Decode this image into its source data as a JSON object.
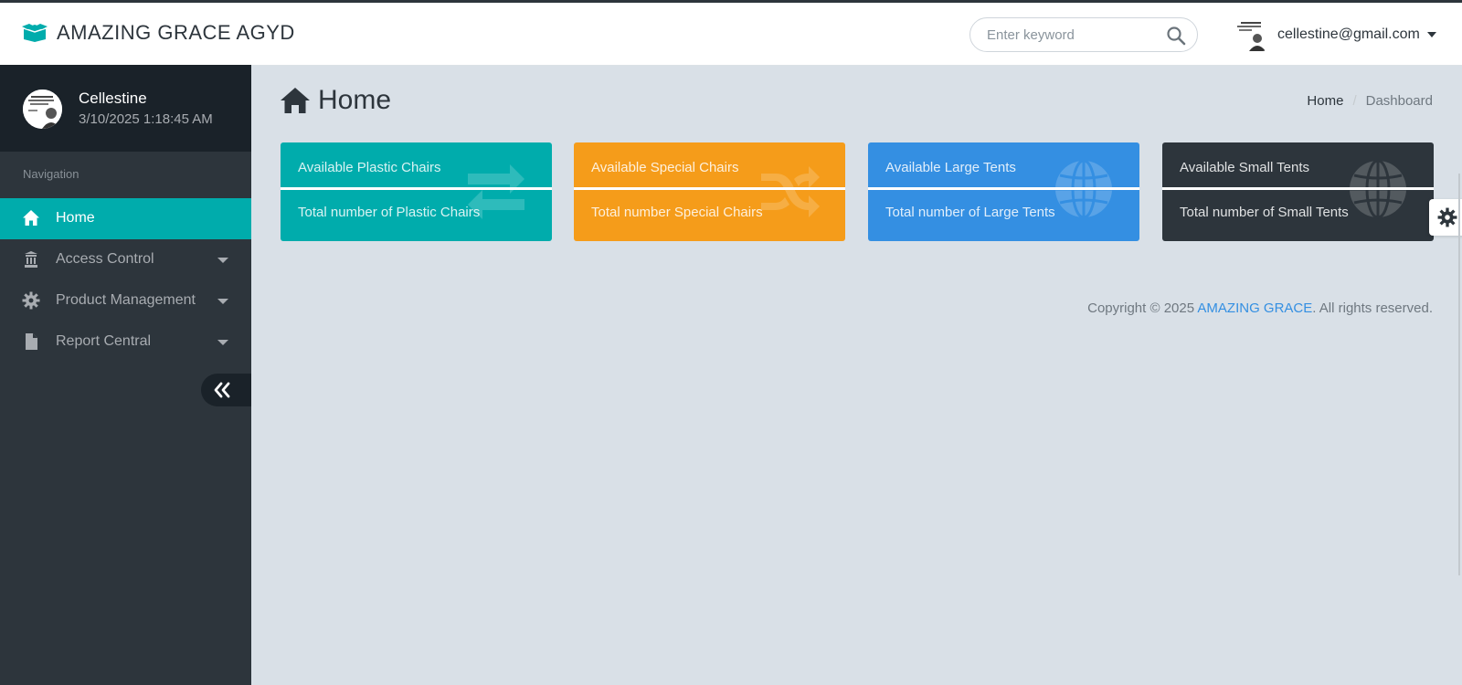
{
  "header": {
    "brand": "AMAZING GRACE AGYD",
    "search_placeholder": "Enter keyword",
    "user_email": "cellestine@gmail.com"
  },
  "sidebar": {
    "profile": {
      "name": "Cellestine",
      "timestamp": "3/10/2025 1:18:45 AM"
    },
    "nav_header": "Navigation",
    "items": [
      {
        "label": "Home",
        "icon": "home-icon",
        "active": true
      },
      {
        "label": "Access Control",
        "icon": "building-icon",
        "active": false
      },
      {
        "label": "Product Management",
        "icon": "gear-icon",
        "active": false
      },
      {
        "label": "Report Central",
        "icon": "file-icon",
        "active": false
      }
    ]
  },
  "main": {
    "title": "Home",
    "breadcrumb": {
      "home": "Home",
      "separator": "/",
      "current": "Dashboard"
    },
    "cards": [
      {
        "title": "Available Plastic Chairs",
        "subtitle": "Total number of Plastic Chairs",
        "icon": "exchange-icon",
        "color": "#00acac"
      },
      {
        "title": "Available Special Chairs",
        "subtitle": "Total number Special Chairs",
        "icon": "shuffle-icon",
        "color": "#f59c1a"
      },
      {
        "title": "Available Large Tents",
        "subtitle": "Total number of Large Tents",
        "icon": "globe-icon",
        "color": "#348fe2"
      },
      {
        "title": "Available Small Tents",
        "subtitle": "Total number of Small Tents",
        "icon": "globe-icon",
        "color": "#2d353c"
      }
    ],
    "footer": {
      "prefix": "Copyright © 2025 ",
      "brand": "AMAZING GRACE",
      "suffix": ". All rights reserved."
    }
  },
  "colors": {
    "accent": "#00acac",
    "sidebar_bg": "#2d353c",
    "content_bg": "#d9e0e7"
  }
}
